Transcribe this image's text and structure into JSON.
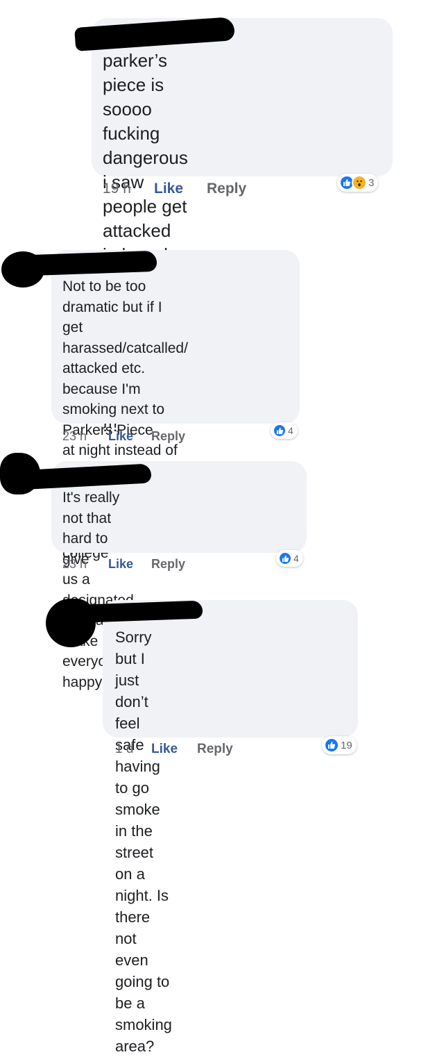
{
  "comments": [
    {
      "text": "parker’s piece is soooo fucking\ndangerous i saw people get\nattacked in broad daylight i\ndon’t wanna have to smoke\nover there !!!",
      "time": "19 h",
      "like_label": "Like",
      "reply_label": "Reply",
      "reaction_count": "3",
      "reactions": [
        "thumbs-up-icon",
        "wow-face-icon"
      ]
    },
    {
      "text": "Not to be too dramatic but if I\nget harassed/catcalled/\nattacked etc. because I'm\nsmoking next to Parkers Piece\nat night instead of safe inside\ncollege gates I'm blaming this\npolicy and suing college",
      "time": "23 h",
      "like_label": "Like",
      "reply_label": "Reply",
      "reaction_count": "4",
      "reactions": [
        "thumbs-up-icon"
      ]
    },
    {
      "text": "It's really not that hard to give\nus a designated area and make\neveryone happy-ish",
      "time": "23 h",
      "like_label": "Like",
      "reply_label": "Reply",
      "reaction_count": "4",
      "reactions": [
        "thumbs-up-icon"
      ]
    },
    {
      "text": "Sorry but I just don’t feel safe\nhaving to go smoke in the\nstreet on a night. Is there not\neven going to be a smoking\narea?",
      "time": "1 d",
      "like_label": "Like",
      "reply_label": "Reply",
      "reaction_count": "19",
      "reactions": [
        "thumbs-up-icon"
      ]
    }
  ],
  "colors": {
    "bubble": "#f0f2f5",
    "link": "#385898",
    "meta": "#65676b",
    "like_reaction": "#1877f2",
    "wow_reaction": "#f7b125"
  }
}
